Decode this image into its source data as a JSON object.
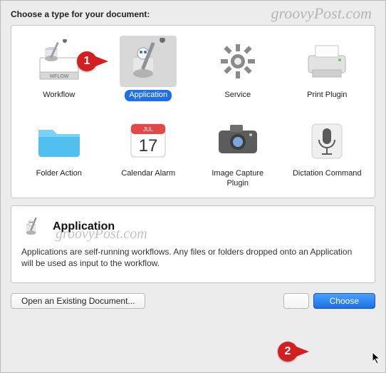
{
  "header": "Choose a type for your document:",
  "types": [
    {
      "id": "workflow",
      "label": "Workflow"
    },
    {
      "id": "application",
      "label": "Application"
    },
    {
      "id": "service",
      "label": "Service"
    },
    {
      "id": "print-plugin",
      "label": "Print Plugin"
    },
    {
      "id": "folder-action",
      "label": "Folder Action"
    },
    {
      "id": "calendar-alarm",
      "label": "Calendar Alarm"
    },
    {
      "id": "image-capture",
      "label": "Image Capture Plugin"
    },
    {
      "id": "dictation",
      "label": "Dictation Command"
    }
  ],
  "selected_index": 1,
  "description": {
    "title": "Application",
    "body": "Applications are self-running workflows. Any files or folders dropped onto an Application will be used as input to the workflow."
  },
  "buttons": {
    "open_existing": "Open an Existing Document...",
    "close": "",
    "choose": "Choose"
  },
  "calendar_icon": {
    "month": "JUL",
    "day": "17"
  },
  "callouts": {
    "one": "1",
    "two": "2"
  },
  "watermark": "groovyPost.com"
}
